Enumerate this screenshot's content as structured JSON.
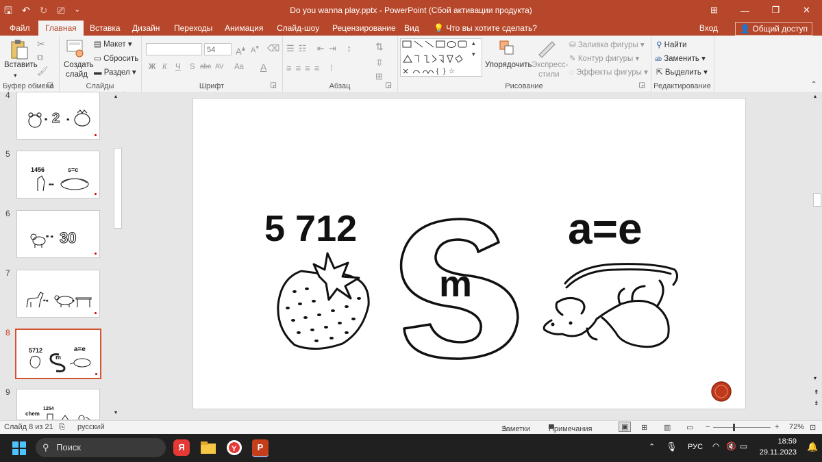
{
  "window": {
    "title": "Do you wanna play.pptx - PowerPoint (Сбой активации продукта)",
    "controls": [
      "⊞",
      "—",
      "❐",
      "✕"
    ]
  },
  "tabs": [
    "Файл",
    "Главная",
    "Вставка",
    "Дизайн",
    "Переходы",
    "Анимация",
    "Слайд-шоу",
    "Рецензирование",
    "Вид"
  ],
  "tell_me": "Что вы хотите сделать?",
  "signin": "Вход",
  "share": "Общий доступ",
  "ribbon": {
    "clipboard": {
      "label": "Буфер обмена",
      "paste": "Вставить"
    },
    "slides": {
      "label": "Слайды",
      "new_slide": "Создать",
      "new_slide2": "слайд",
      "layout": "Макет",
      "reset": "Сбросить",
      "section": "Раздел"
    },
    "font": {
      "label": "Шрифт",
      "size": "54",
      "bold": "Ж",
      "italic": "К",
      "underline": "Ч",
      "shadow": "S",
      "strike": "abc",
      "spacing": "AV",
      "case": "Aa",
      "color": "A"
    },
    "paragraph": {
      "label": "Абзац"
    },
    "drawing": {
      "label": "Рисование",
      "arrange": "Упорядочить",
      "quick_styles": "Экспресс-",
      "quick_styles2": "стили",
      "fill": "Заливка фигуры",
      "outline": "Контур фигуры",
      "effects": "Эффекты фигуры"
    },
    "editing": {
      "label": "Редактирование",
      "find": "Найти",
      "replace": "Заменить",
      "select": "Выделить"
    }
  },
  "thumbnails": [
    {
      "num": "4",
      "text1": "2",
      "text2": ""
    },
    {
      "num": "5",
      "text1": "1456",
      "text2": "s=c"
    },
    {
      "num": "6",
      "text1": "30",
      "text2": ""
    },
    {
      "num": "7",
      "text1": "",
      "text2": ""
    },
    {
      "num": "8",
      "text1": "5712",
      "text2": "a=e",
      "mid": "m"
    },
    {
      "num": "9",
      "text1": "1254",
      "text2": "chem"
    }
  ],
  "slide": {
    "numbers": "5 712",
    "letter_in_s": "m",
    "equation": "a=e"
  },
  "status": {
    "slide_of": "Слайд 8 из 21",
    "language": "русский",
    "notes": "Заметки",
    "comments": "Примечания",
    "zoom": "72%"
  },
  "taskbar": {
    "search": "Поиск",
    "lang": "РУС",
    "time": "18:59",
    "date": "29.11.2023"
  }
}
